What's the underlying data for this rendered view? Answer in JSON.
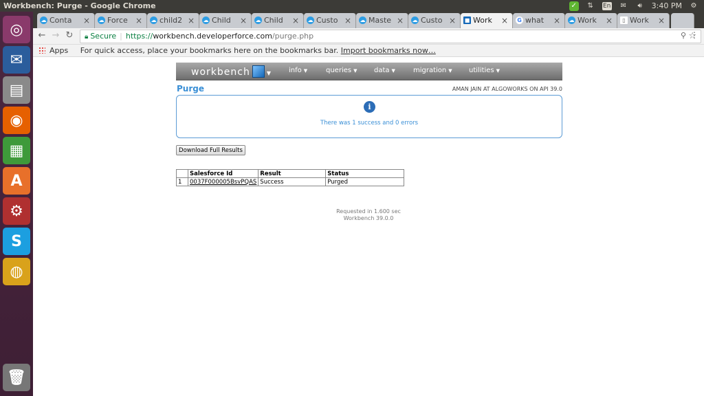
{
  "window": {
    "title": "Workbench: Purge - Google Chrome"
  },
  "tray": {
    "lang": "En",
    "time": "3:40 PM"
  },
  "tabs": [
    {
      "label": "Conta"
    },
    {
      "label": "Force"
    },
    {
      "label": "child2"
    },
    {
      "label": "Child"
    },
    {
      "label": "Child"
    },
    {
      "label": "Custo"
    },
    {
      "label": "Maste"
    },
    {
      "label": "Custo"
    },
    {
      "label": "Work",
      "active": true
    },
    {
      "label": "what"
    },
    {
      "label": "Work"
    },
    {
      "label": "Work"
    }
  ],
  "address": {
    "secure_label": "Secure",
    "scheme": "https://",
    "host": "workbench.developerforce.com",
    "path": "/purge.php"
  },
  "bookmarks": {
    "apps_label": "Apps",
    "hint": "For quick access, place your bookmarks here on the bookmarks bar.",
    "import_link": "Import bookmarks now…"
  },
  "workbench": {
    "logo": "workbench",
    "menu": [
      "info",
      "queries",
      "data",
      "migration",
      "utilities"
    ],
    "page_title": "Purge",
    "user_info": "AMAN JAIN AT ALGOWORKS ON API 39.0",
    "message": "There was 1 success and 0 errors",
    "download_button": "Download Full Results",
    "table": {
      "headers": [
        "",
        "Salesforce Id",
        "Result",
        "Status"
      ],
      "rows": [
        [
          "1",
          "0037F000005BsvPQAS",
          "Success",
          "Purged"
        ]
      ]
    },
    "footer": {
      "timing": "Requested in 1.600 sec",
      "version": "Workbench 39.0.0"
    }
  }
}
